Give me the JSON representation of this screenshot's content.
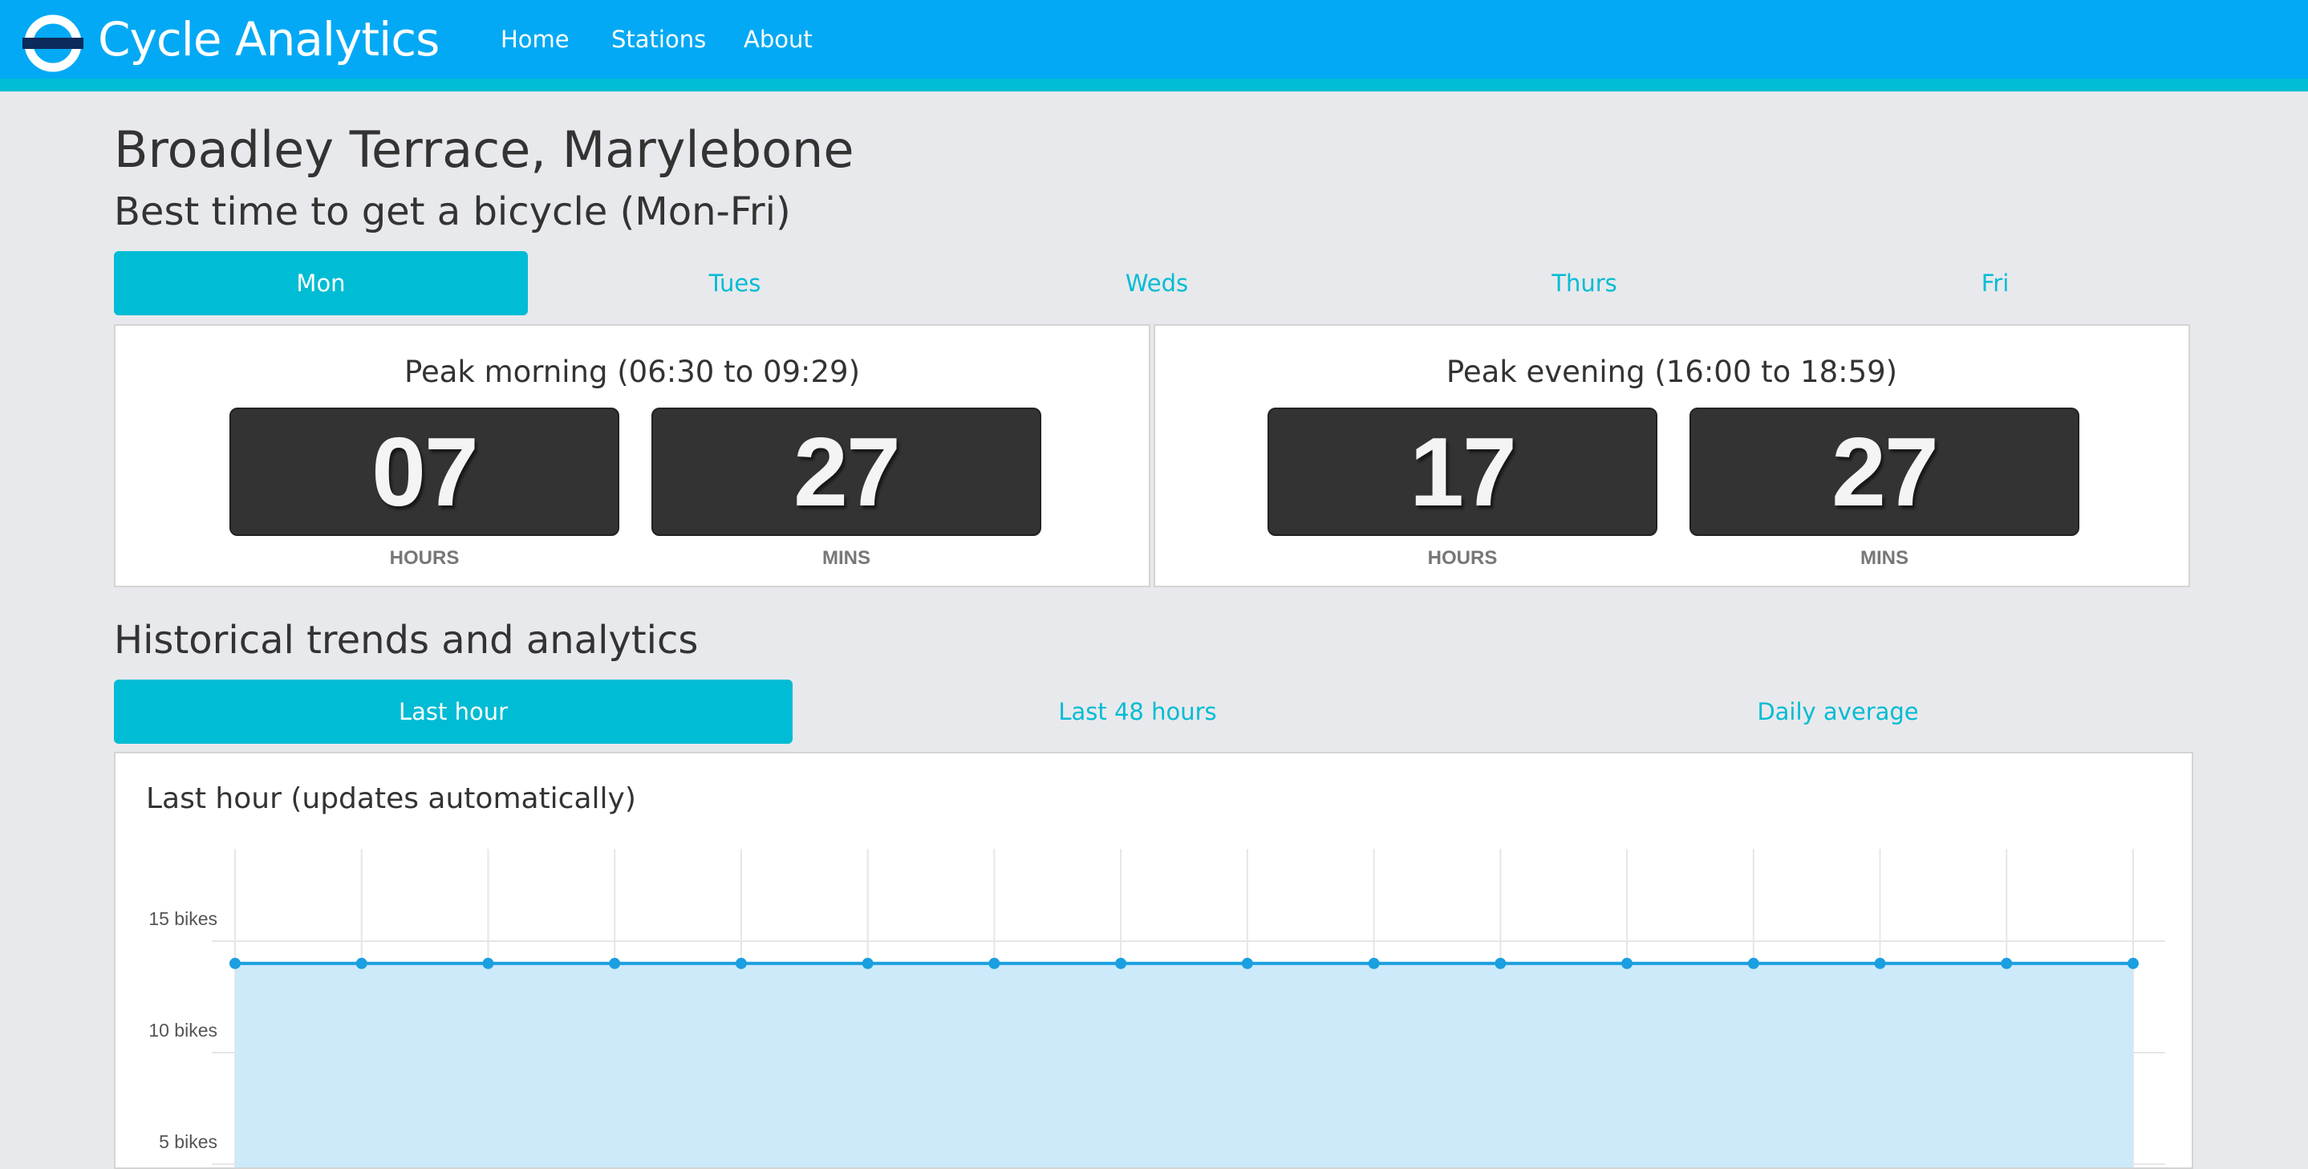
{
  "app": {
    "brand": "Cycle Analytics",
    "nav": [
      "Home",
      "Stations",
      "About"
    ],
    "colors": {
      "primary": "#03a9f4",
      "accent": "#00bcd4",
      "background": "#e8e9ec"
    }
  },
  "station": {
    "name": "Broadley Terrace, Marylebone"
  },
  "best_time": {
    "heading": "Best time to get a bicycle (Mon-Fri)",
    "days": [
      "Mon",
      "Tues",
      "Weds",
      "Thurs",
      "Fri"
    ],
    "active_day": "Mon",
    "morning": {
      "title": "Peak morning (06:30 to 09:29)",
      "hours": "07",
      "mins": "27"
    },
    "evening": {
      "title": "Peak evening (16:00 to 18:59)",
      "hours": "17",
      "mins": "27"
    },
    "hours_label": "HOURS",
    "mins_label": "MINS"
  },
  "history": {
    "heading": "Historical trends and analytics",
    "tabs": [
      "Last hour",
      "Last 48 hours",
      "Daily average"
    ],
    "active_tab": "Last hour",
    "chart_title": "Last hour (updates automatically)"
  },
  "chart_data": {
    "type": "area",
    "title": "Last hour (updates automatically)",
    "y_tick_labels": [
      "15 bikes",
      "10 bikes",
      "5 bikes"
    ],
    "y_ticks": [
      15,
      10,
      5
    ],
    "ylim": [
      0,
      18
    ],
    "grid": true,
    "series": [
      {
        "values": [
          14,
          14,
          14,
          14,
          14,
          14,
          14,
          14,
          14,
          14,
          14,
          14,
          14,
          14,
          14,
          14
        ]
      }
    ],
    "colors": {
      "line": "#1a9fe0",
      "fill": "#cdeafa",
      "grid": "#e6e6e6"
    }
  }
}
